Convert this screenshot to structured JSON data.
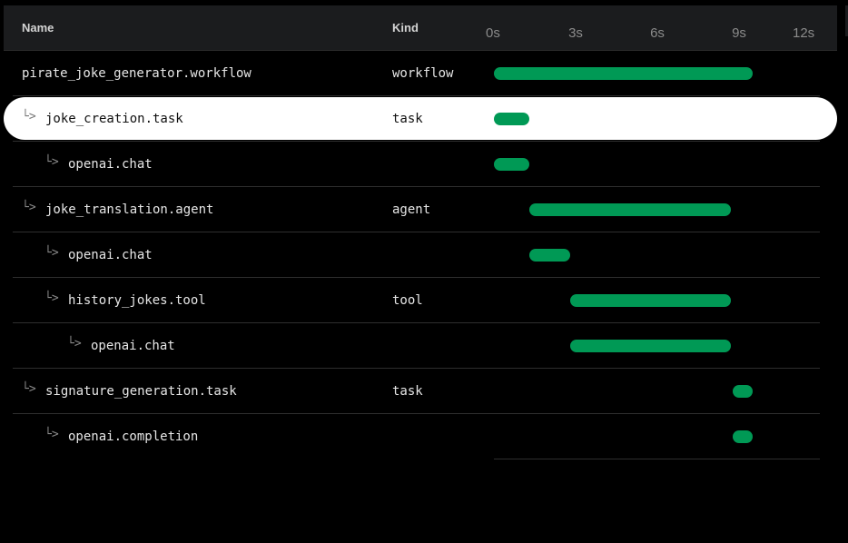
{
  "header": {
    "name_label": "Name",
    "kind_label": "Kind"
  },
  "timeline": {
    "ticks": [
      "0s",
      "3s",
      "6s",
      "9s",
      "12s"
    ],
    "max_seconds": 12
  },
  "colors": {
    "bar": "#009955",
    "selected_row_bg": "#ffffff",
    "header_bg": "#1b1c1e"
  },
  "rows": [
    {
      "name": "pirate_joke_generator.workflow",
      "kind": "workflow",
      "depth": 0,
      "has_arrow": false,
      "selected": false,
      "start_s": 0.0,
      "end_s": 9.5
    },
    {
      "name": "joke_creation.task",
      "kind": "task",
      "depth": 1,
      "has_arrow": true,
      "selected": true,
      "start_s": 0.0,
      "end_s": 1.3
    },
    {
      "name": "openai.chat",
      "kind": "",
      "depth": 2,
      "has_arrow": true,
      "selected": false,
      "start_s": 0.0,
      "end_s": 1.3
    },
    {
      "name": "joke_translation.agent",
      "kind": "agent",
      "depth": 1,
      "has_arrow": true,
      "selected": false,
      "start_s": 1.3,
      "end_s": 8.7
    },
    {
      "name": "openai.chat",
      "kind": "",
      "depth": 2,
      "has_arrow": true,
      "selected": false,
      "start_s": 1.3,
      "end_s": 2.8
    },
    {
      "name": "history_jokes.tool",
      "kind": "tool",
      "depth": 2,
      "has_arrow": true,
      "selected": false,
      "start_s": 2.8,
      "end_s": 8.7
    },
    {
      "name": "openai.chat",
      "kind": "",
      "depth": 3,
      "has_arrow": true,
      "selected": false,
      "start_s": 2.8,
      "end_s": 8.7
    },
    {
      "name": "signature_generation.task",
      "kind": "task",
      "depth": 1,
      "has_arrow": true,
      "selected": false,
      "start_s": 8.75,
      "end_s": 9.5
    },
    {
      "name": "openai.completion",
      "kind": "",
      "depth": 2,
      "has_arrow": true,
      "selected": false,
      "start_s": 8.75,
      "end_s": 9.5
    }
  ]
}
